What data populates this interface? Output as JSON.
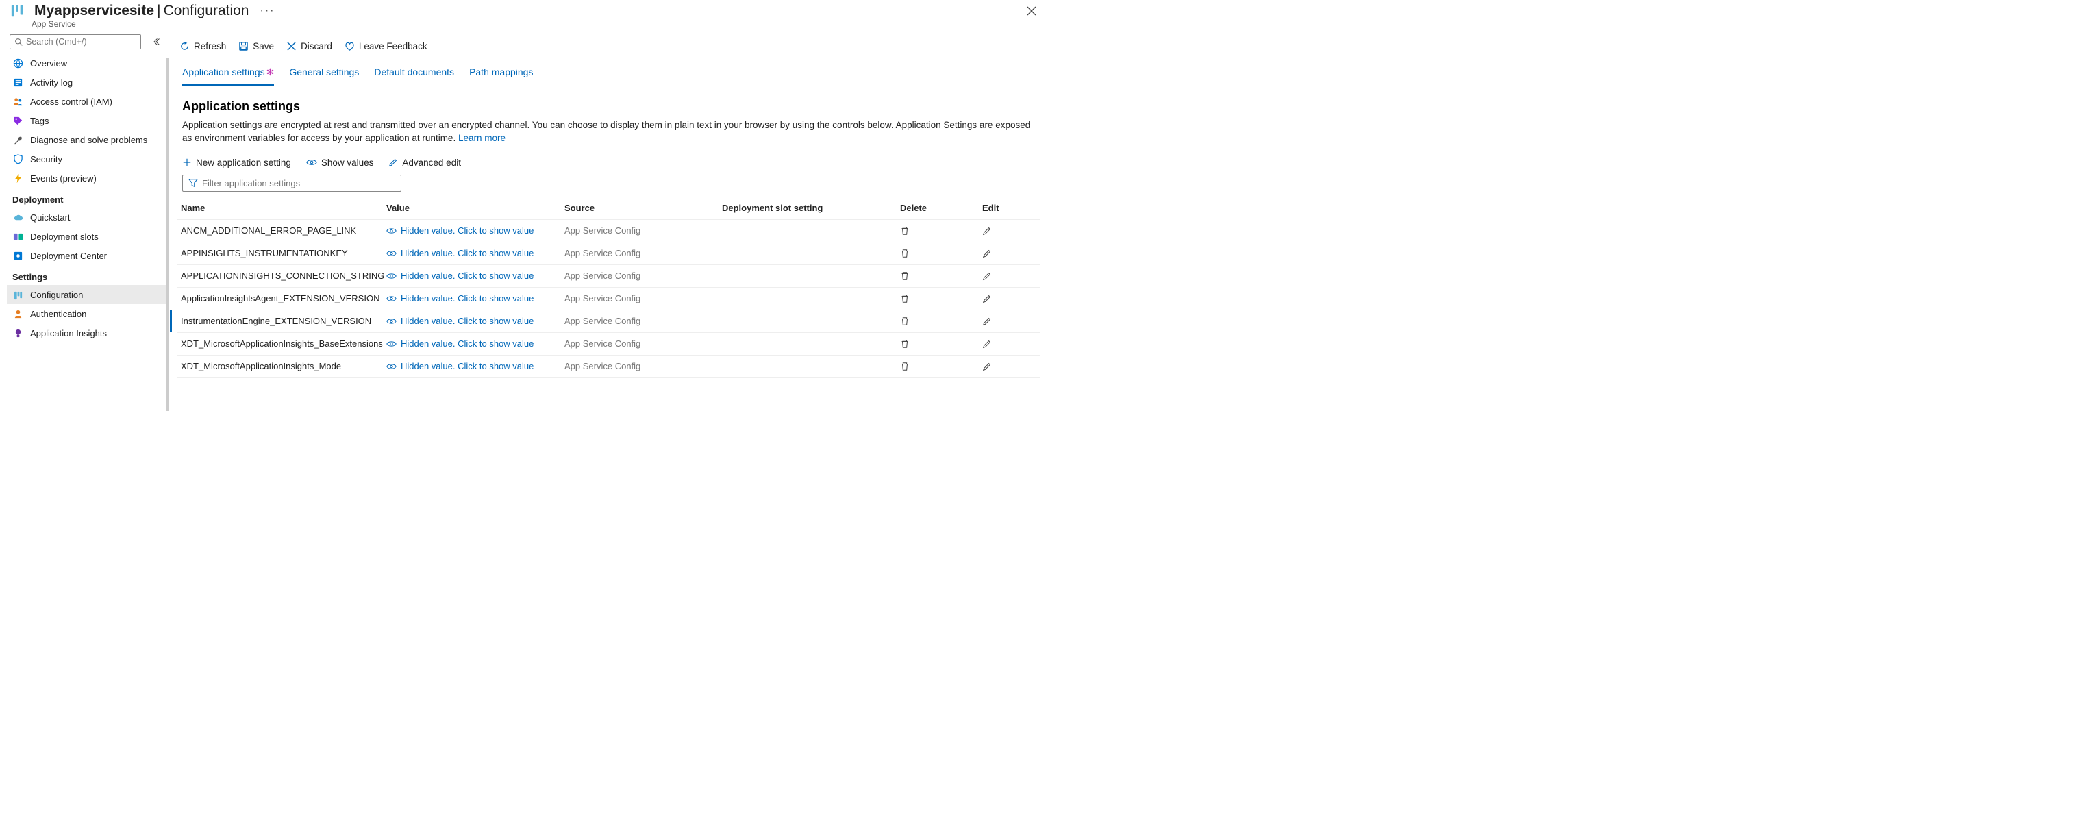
{
  "header": {
    "app_name": "Myappservicesite",
    "page": "Configuration",
    "subtitle": "App Service"
  },
  "sidebar": {
    "search_placeholder": "Search (Cmd+/)",
    "items_top": [
      {
        "label": "Overview",
        "icon": "globe"
      },
      {
        "label": "Activity log",
        "icon": "log"
      },
      {
        "label": "Access control (IAM)",
        "icon": "iam"
      },
      {
        "label": "Tags",
        "icon": "tag"
      },
      {
        "label": "Diagnose and solve problems",
        "icon": "wrench"
      },
      {
        "label": "Security",
        "icon": "shield"
      },
      {
        "label": "Events (preview)",
        "icon": "bolt"
      }
    ],
    "section_deployment": "Deployment",
    "items_deployment": [
      {
        "label": "Quickstart",
        "icon": "cloud"
      },
      {
        "label": "Deployment slots",
        "icon": "slots"
      },
      {
        "label": "Deployment Center",
        "icon": "depcenter"
      }
    ],
    "section_settings": "Settings",
    "items_settings": [
      {
        "label": "Configuration",
        "icon": "config"
      },
      {
        "label": "Authentication",
        "icon": "auth"
      },
      {
        "label": "Application Insights",
        "icon": "appinsights"
      }
    ]
  },
  "toolbar": {
    "refresh": "Refresh",
    "save": "Save",
    "discard": "Discard",
    "feedback": "Leave Feedback"
  },
  "tabs": {
    "app_settings": "Application settings",
    "general": "General settings",
    "docs": "Default documents",
    "paths": "Path mappings"
  },
  "section": {
    "title": "Application settings",
    "description": "Application settings are encrypted at rest and transmitted over an encrypted channel. You can choose to display them in plain text in your browser by using the controls below. Application Settings are exposed as environment variables for access by your application at runtime. ",
    "learn_more": "Learn more"
  },
  "sub_toolbar": {
    "new": "New application setting",
    "show": "Show values",
    "advanced": "Advanced edit",
    "filter_placeholder": "Filter application settings"
  },
  "table": {
    "headers": {
      "name": "Name",
      "value": "Value",
      "source": "Source",
      "slot": "Deployment slot setting",
      "delete": "Delete",
      "edit": "Edit"
    },
    "hidden_value": "Hidden value. Click to show value",
    "source_value": "App Service Config",
    "rows": [
      {
        "name": "ANCM_ADDITIONAL_ERROR_PAGE_LINK"
      },
      {
        "name": "APPINSIGHTS_INSTRUMENTATIONKEY"
      },
      {
        "name": "APPLICATIONINSIGHTS_CONNECTION_STRING"
      },
      {
        "name": "ApplicationInsightsAgent_EXTENSION_VERSION"
      },
      {
        "name": "InstrumentationEngine_EXTENSION_VERSION"
      },
      {
        "name": "XDT_MicrosoftApplicationInsights_BaseExtensions"
      },
      {
        "name": "XDT_MicrosoftApplicationInsights_Mode"
      }
    ]
  }
}
